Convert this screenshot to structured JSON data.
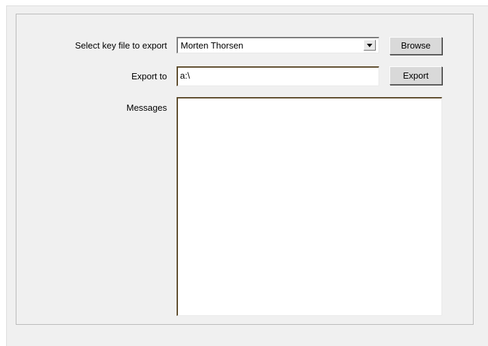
{
  "form": {
    "key_file_label": "Select key file to export",
    "key_file_value": "Morten Thorsen",
    "browse_label": "Browse",
    "export_to_label": "Export to",
    "export_to_value": "a:\\",
    "export_label": "Export",
    "messages_label": "Messages",
    "messages_value": ""
  },
  "icons": {
    "dropdown": "chevron-down-icon"
  }
}
